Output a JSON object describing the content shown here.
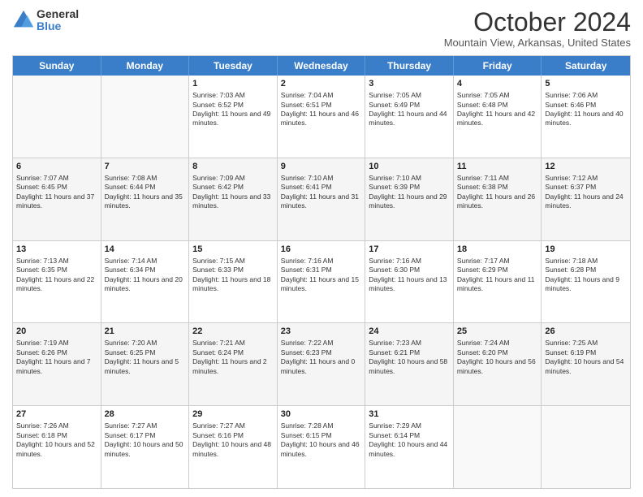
{
  "logo": {
    "general": "General",
    "blue": "Blue"
  },
  "header": {
    "month": "October 2024",
    "location": "Mountain View, Arkansas, United States"
  },
  "weekdays": [
    "Sunday",
    "Monday",
    "Tuesday",
    "Wednesday",
    "Thursday",
    "Friday",
    "Saturday"
  ],
  "weeks": [
    [
      {
        "day": "",
        "info": ""
      },
      {
        "day": "",
        "info": ""
      },
      {
        "day": "1",
        "info": "Sunrise: 7:03 AM\nSunset: 6:52 PM\nDaylight: 11 hours and 49 minutes."
      },
      {
        "day": "2",
        "info": "Sunrise: 7:04 AM\nSunset: 6:51 PM\nDaylight: 11 hours and 46 minutes."
      },
      {
        "day": "3",
        "info": "Sunrise: 7:05 AM\nSunset: 6:49 PM\nDaylight: 11 hours and 44 minutes."
      },
      {
        "day": "4",
        "info": "Sunrise: 7:05 AM\nSunset: 6:48 PM\nDaylight: 11 hours and 42 minutes."
      },
      {
        "day": "5",
        "info": "Sunrise: 7:06 AM\nSunset: 6:46 PM\nDaylight: 11 hours and 40 minutes."
      }
    ],
    [
      {
        "day": "6",
        "info": "Sunrise: 7:07 AM\nSunset: 6:45 PM\nDaylight: 11 hours and 37 minutes."
      },
      {
        "day": "7",
        "info": "Sunrise: 7:08 AM\nSunset: 6:44 PM\nDaylight: 11 hours and 35 minutes."
      },
      {
        "day": "8",
        "info": "Sunrise: 7:09 AM\nSunset: 6:42 PM\nDaylight: 11 hours and 33 minutes."
      },
      {
        "day": "9",
        "info": "Sunrise: 7:10 AM\nSunset: 6:41 PM\nDaylight: 11 hours and 31 minutes."
      },
      {
        "day": "10",
        "info": "Sunrise: 7:10 AM\nSunset: 6:39 PM\nDaylight: 11 hours and 29 minutes."
      },
      {
        "day": "11",
        "info": "Sunrise: 7:11 AM\nSunset: 6:38 PM\nDaylight: 11 hours and 26 minutes."
      },
      {
        "day": "12",
        "info": "Sunrise: 7:12 AM\nSunset: 6:37 PM\nDaylight: 11 hours and 24 minutes."
      }
    ],
    [
      {
        "day": "13",
        "info": "Sunrise: 7:13 AM\nSunset: 6:35 PM\nDaylight: 11 hours and 22 minutes."
      },
      {
        "day": "14",
        "info": "Sunrise: 7:14 AM\nSunset: 6:34 PM\nDaylight: 11 hours and 20 minutes."
      },
      {
        "day": "15",
        "info": "Sunrise: 7:15 AM\nSunset: 6:33 PM\nDaylight: 11 hours and 18 minutes."
      },
      {
        "day": "16",
        "info": "Sunrise: 7:16 AM\nSunset: 6:31 PM\nDaylight: 11 hours and 15 minutes."
      },
      {
        "day": "17",
        "info": "Sunrise: 7:16 AM\nSunset: 6:30 PM\nDaylight: 11 hours and 13 minutes."
      },
      {
        "day": "18",
        "info": "Sunrise: 7:17 AM\nSunset: 6:29 PM\nDaylight: 11 hours and 11 minutes."
      },
      {
        "day": "19",
        "info": "Sunrise: 7:18 AM\nSunset: 6:28 PM\nDaylight: 11 hours and 9 minutes."
      }
    ],
    [
      {
        "day": "20",
        "info": "Sunrise: 7:19 AM\nSunset: 6:26 PM\nDaylight: 11 hours and 7 minutes."
      },
      {
        "day": "21",
        "info": "Sunrise: 7:20 AM\nSunset: 6:25 PM\nDaylight: 11 hours and 5 minutes."
      },
      {
        "day": "22",
        "info": "Sunrise: 7:21 AM\nSunset: 6:24 PM\nDaylight: 11 hours and 2 minutes."
      },
      {
        "day": "23",
        "info": "Sunrise: 7:22 AM\nSunset: 6:23 PM\nDaylight: 11 hours and 0 minutes."
      },
      {
        "day": "24",
        "info": "Sunrise: 7:23 AM\nSunset: 6:21 PM\nDaylight: 10 hours and 58 minutes."
      },
      {
        "day": "25",
        "info": "Sunrise: 7:24 AM\nSunset: 6:20 PM\nDaylight: 10 hours and 56 minutes."
      },
      {
        "day": "26",
        "info": "Sunrise: 7:25 AM\nSunset: 6:19 PM\nDaylight: 10 hours and 54 minutes."
      }
    ],
    [
      {
        "day": "27",
        "info": "Sunrise: 7:26 AM\nSunset: 6:18 PM\nDaylight: 10 hours and 52 minutes."
      },
      {
        "day": "28",
        "info": "Sunrise: 7:27 AM\nSunset: 6:17 PM\nDaylight: 10 hours and 50 minutes."
      },
      {
        "day": "29",
        "info": "Sunrise: 7:27 AM\nSunset: 6:16 PM\nDaylight: 10 hours and 48 minutes."
      },
      {
        "day": "30",
        "info": "Sunrise: 7:28 AM\nSunset: 6:15 PM\nDaylight: 10 hours and 46 minutes."
      },
      {
        "day": "31",
        "info": "Sunrise: 7:29 AM\nSunset: 6:14 PM\nDaylight: 10 hours and 44 minutes."
      },
      {
        "day": "",
        "info": ""
      },
      {
        "day": "",
        "info": ""
      }
    ]
  ]
}
